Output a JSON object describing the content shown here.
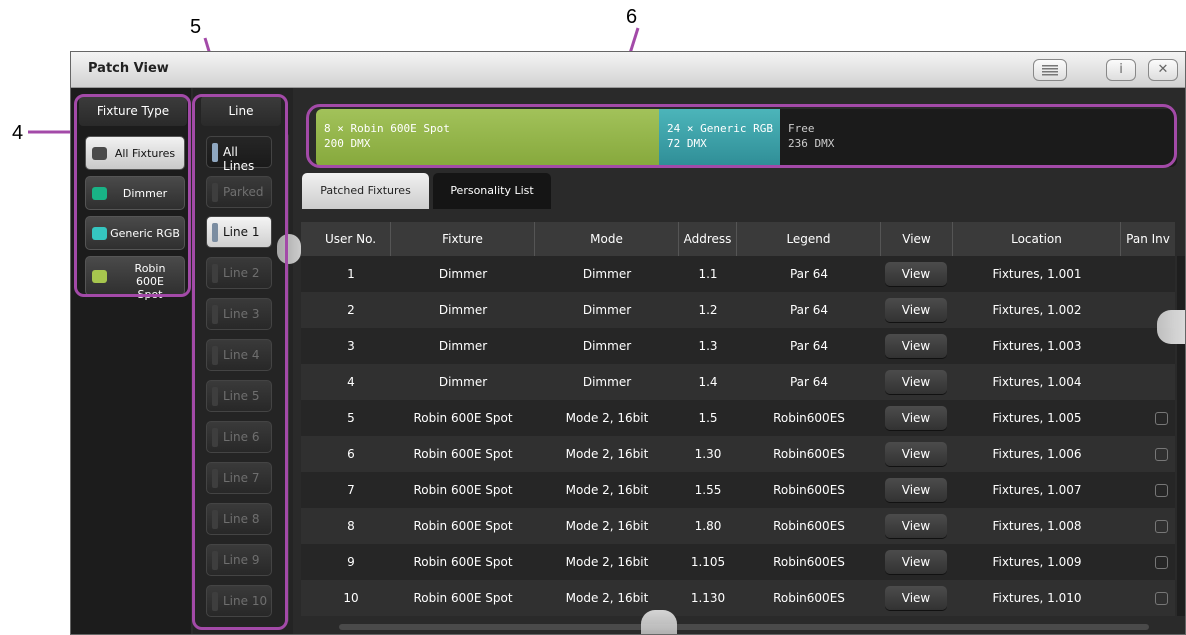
{
  "annotations": {
    "n4": "4",
    "n5": "5",
    "n6": "6"
  },
  "window": {
    "title": "Patch View",
    "menu_icon": "menu-icon",
    "info_label": "i",
    "close_label": "✕"
  },
  "fixture_type": {
    "header": "Fixture Type",
    "items": [
      {
        "label": "All Fixtures",
        "color": "#4a4a4a"
      },
      {
        "label": "Dimmer",
        "color": "#19b386"
      },
      {
        "label": "Generic RGB",
        "color": "#35c6c0"
      },
      {
        "label": "Robin 600E Spot",
        "color": "#a7c64e"
      }
    ]
  },
  "line": {
    "header": "Line",
    "items": [
      "All Lines",
      "Parked",
      "Line 1",
      "Line 2",
      "Line 3",
      "Line 4",
      "Line 5",
      "Line 6",
      "Line 7",
      "Line 8",
      "Line 9",
      "Line 10"
    ]
  },
  "dmx_usage": [
    {
      "line1": "8 × Robin 600E Spot",
      "line2": "200 DMX",
      "color": "#8aaa40"
    },
    {
      "line1": "24 × Generic RGB",
      "line2": "72 DMX",
      "color": "#3e9ba2"
    },
    {
      "line1": "Free",
      "line2": "236 DMX",
      "color": "#1b1b1b"
    }
  ],
  "tabs": [
    "Patched Fixtures",
    "Personality List"
  ],
  "table": {
    "columns": [
      "User No.",
      "Fixture",
      "Mode",
      "Address",
      "Legend",
      "View",
      "Location",
      "Pan Inv"
    ],
    "rows": [
      [
        "1",
        "Dimmer",
        "Dimmer",
        "1.1",
        "Par 64",
        "View",
        "Fixtures, 1.001"
      ],
      [
        "2",
        "Dimmer",
        "Dimmer",
        "1.2",
        "Par 64",
        "View",
        "Fixtures, 1.002"
      ],
      [
        "3",
        "Dimmer",
        "Dimmer",
        "1.3",
        "Par 64",
        "View",
        "Fixtures, 1.003"
      ],
      [
        "4",
        "Dimmer",
        "Dimmer",
        "1.4",
        "Par 64",
        "View",
        "Fixtures, 1.004"
      ],
      [
        "5",
        "Robin 600E Spot",
        "Mode 2, 16bit",
        "1.5",
        "Robin600ES",
        "View",
        "Fixtures, 1.005"
      ],
      [
        "6",
        "Robin 600E Spot",
        "Mode 2, 16bit",
        "1.30",
        "Robin600ES",
        "View",
        "Fixtures, 1.006"
      ],
      [
        "7",
        "Robin 600E Spot",
        "Mode 2, 16bit",
        "1.55",
        "Robin600ES",
        "View",
        "Fixtures, 1.007"
      ],
      [
        "8",
        "Robin 600E Spot",
        "Mode 2, 16bit",
        "1.80",
        "Robin600ES",
        "View",
        "Fixtures, 1.008"
      ],
      [
        "9",
        "Robin 600E Spot",
        "Mode 2, 16bit",
        "1.105",
        "Robin600ES",
        "View",
        "Fixtures, 1.009"
      ],
      [
        "10",
        "Robin 600E Spot",
        "Mode 2, 16bit",
        "1.130",
        "Robin600ES",
        "View",
        "Fixtures, 1.010"
      ]
    ]
  },
  "colors": {
    "dimmer": "#19b386",
    "robin": "#a7c64e",
    "annotation": "#a34aa8"
  }
}
